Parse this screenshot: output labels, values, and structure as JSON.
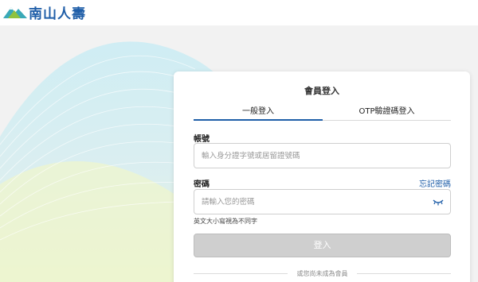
{
  "brand": {
    "name": "南山人壽",
    "color": "#1f5ea8",
    "logo_icon": "mountain-logo-icon"
  },
  "login": {
    "title": "會員登入",
    "tabs": [
      {
        "label": "一般登入",
        "active": true
      },
      {
        "label": "OTP驗證碼登入",
        "active": false
      }
    ],
    "account": {
      "label": "帳號",
      "placeholder": "輸入身分證字號或居留證號碼"
    },
    "password": {
      "label": "密碼",
      "placeholder": "請輸入您的密碼",
      "toggle_icon": "eye-closed-icon"
    },
    "forgot_label": "忘記密碼",
    "case_hint": "英文大小寫視為不同字",
    "submit_label": "登入",
    "divider_text": "或您尚未成為會員"
  },
  "colors": {
    "accent": "#1f5ea8",
    "button_disabled": "#cfcfcf"
  }
}
